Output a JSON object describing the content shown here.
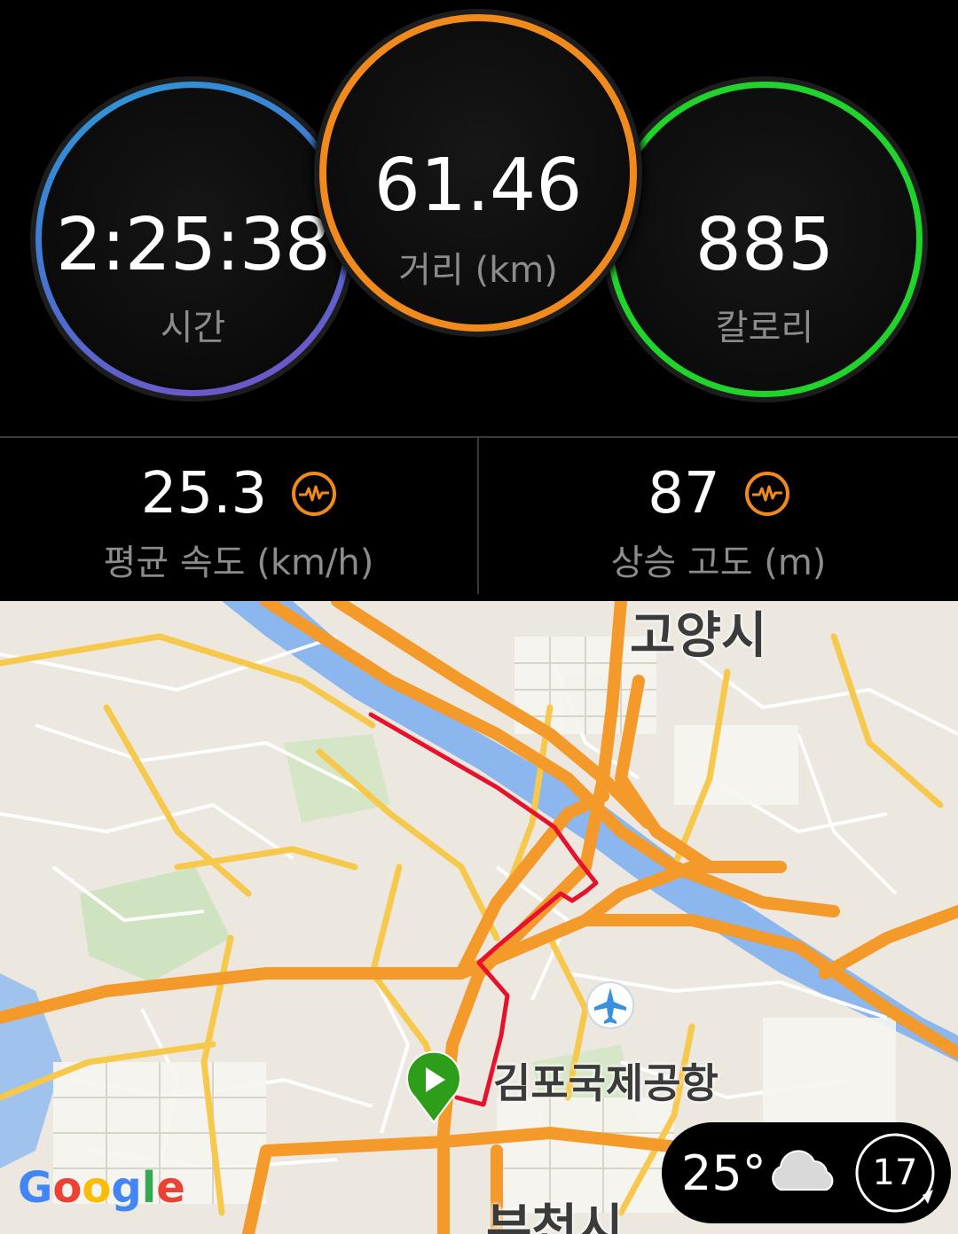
{
  "summary": {
    "time": {
      "value": "2:25:38",
      "label": "시간"
    },
    "distance": {
      "value": "61.46",
      "label": "거리 (km)"
    },
    "calories": {
      "value": "885",
      "label": "칼로리"
    }
  },
  "metrics": {
    "avg_speed": {
      "value": "25.3",
      "label": "평균 속도 (km/h)"
    },
    "elevation_gain": {
      "value": "87",
      "label": "상승 고도 (m)"
    }
  },
  "map": {
    "labels": {
      "goyang": "고양시",
      "airport": "김포국제공항",
      "bucheon": "부천시"
    },
    "attribution": "Google"
  },
  "weather": {
    "temperature": "25°",
    "condition_icon": "cloud-icon",
    "time_badge": "17"
  },
  "colors": {
    "time_ring": "#2a9ad8",
    "distance_ring": "#f08a1c",
    "calories_ring": "#21d42c",
    "route": "#e8112d",
    "start_marker": "#2e9e1a"
  }
}
